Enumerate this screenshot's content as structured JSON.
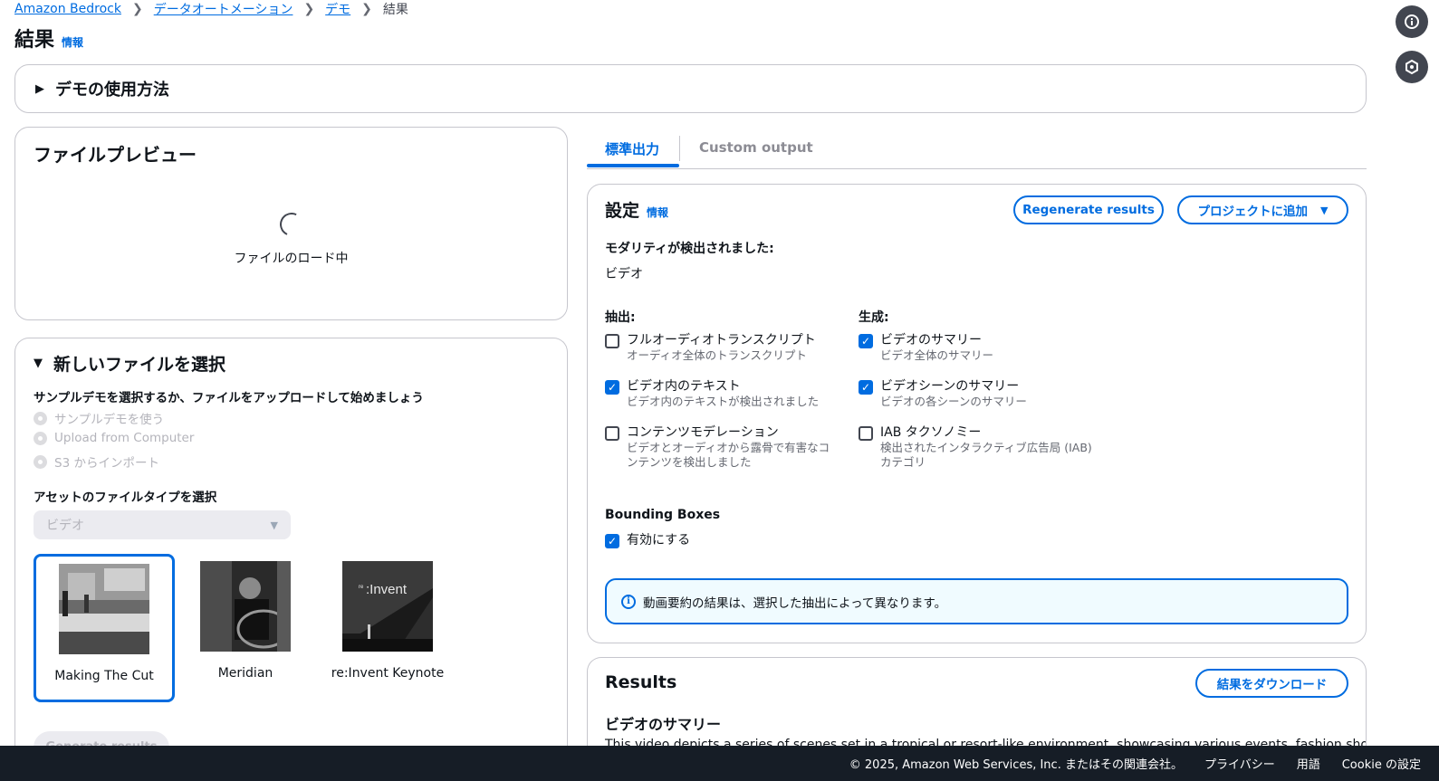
{
  "breadcrumb": {
    "items": [
      "Amazon Bedrock",
      "データオートメーション",
      "デモ"
    ],
    "current": "結果"
  },
  "page": {
    "title": "結果",
    "info": "情報"
  },
  "howto": {
    "title": "デモの使用方法"
  },
  "preview": {
    "title": "ファイルプレビュー",
    "loading": "ファイルのロード中"
  },
  "select_file": {
    "title": "新しいファイルを選択",
    "description": "サンプルデモを選択するか、ファイルをアップロードして始めましょう",
    "radios": [
      "サンプルデモを使う",
      "Upload from Computer",
      "S3 からインポート"
    ],
    "asset_type_label": "アセットのファイルタイプを選択",
    "asset_type_value": "ビデオ",
    "thumbnails": [
      {
        "label": "Making The Cut",
        "selected": true
      },
      {
        "label": "Meridian",
        "selected": false
      },
      {
        "label": "re:Invent Keynote",
        "selected": false
      }
    ],
    "generate_button": "Generate results"
  },
  "tabs": {
    "active": "標準出力",
    "inactive": "Custom output"
  },
  "settings": {
    "title": "設定",
    "info": "情報",
    "regenerate_button": "Regenerate results",
    "add_to_project_button": "プロジェクトに追加",
    "modality_label": "モダリティが検出されました:",
    "modality_value": "ビデオ",
    "extraction_title": "抽出:",
    "generation_title": "生成:",
    "extraction": [
      {
        "label": "フルオーディオトランスクリプト",
        "desc": "オーディオ全体のトランスクリプト",
        "checked": false
      },
      {
        "label": "ビデオ内のテキスト",
        "desc": "ビデオ内のテキストが検出されました",
        "checked": true
      },
      {
        "label": "コンテンツモデレーション",
        "desc": "ビデオとオーディオから露骨で有害なコンテンツを検出しました",
        "checked": false
      }
    ],
    "generation": [
      {
        "label": "ビデオのサマリー",
        "desc": "ビデオ全体のサマリー",
        "checked": true
      },
      {
        "label": "ビデオシーンのサマリー",
        "desc": "ビデオの各シーンのサマリー",
        "checked": true
      },
      {
        "label": "IAB タクソノミー",
        "desc": "検出されたインタラクティブ広告局 (IAB) カテゴリ",
        "checked": false
      }
    ],
    "bounding_boxes_label": "Bounding Boxes",
    "bounding_boxes_option": "有効にする",
    "alert": "動画要約の結果は、選択した抽出によって異なります。"
  },
  "results": {
    "title": "Results",
    "download_button": "結果をダウンロード",
    "summary_title": "ビデオのサマリー",
    "summary_text": "This video depicts a series of scenes set in a tropical or resort-like environment, showcasing various events, fashion shows, and"
  },
  "footer": {
    "copyright": "© 2025, Amazon Web Services, Inc. またはその関連会社。",
    "privacy": "プライバシー",
    "terms": "用語",
    "cookie": "Cookie の設定"
  },
  "colors": {
    "accent": "#006ce0",
    "footer_bg": "#161d26",
    "alert_bg": "#f0fbff"
  }
}
